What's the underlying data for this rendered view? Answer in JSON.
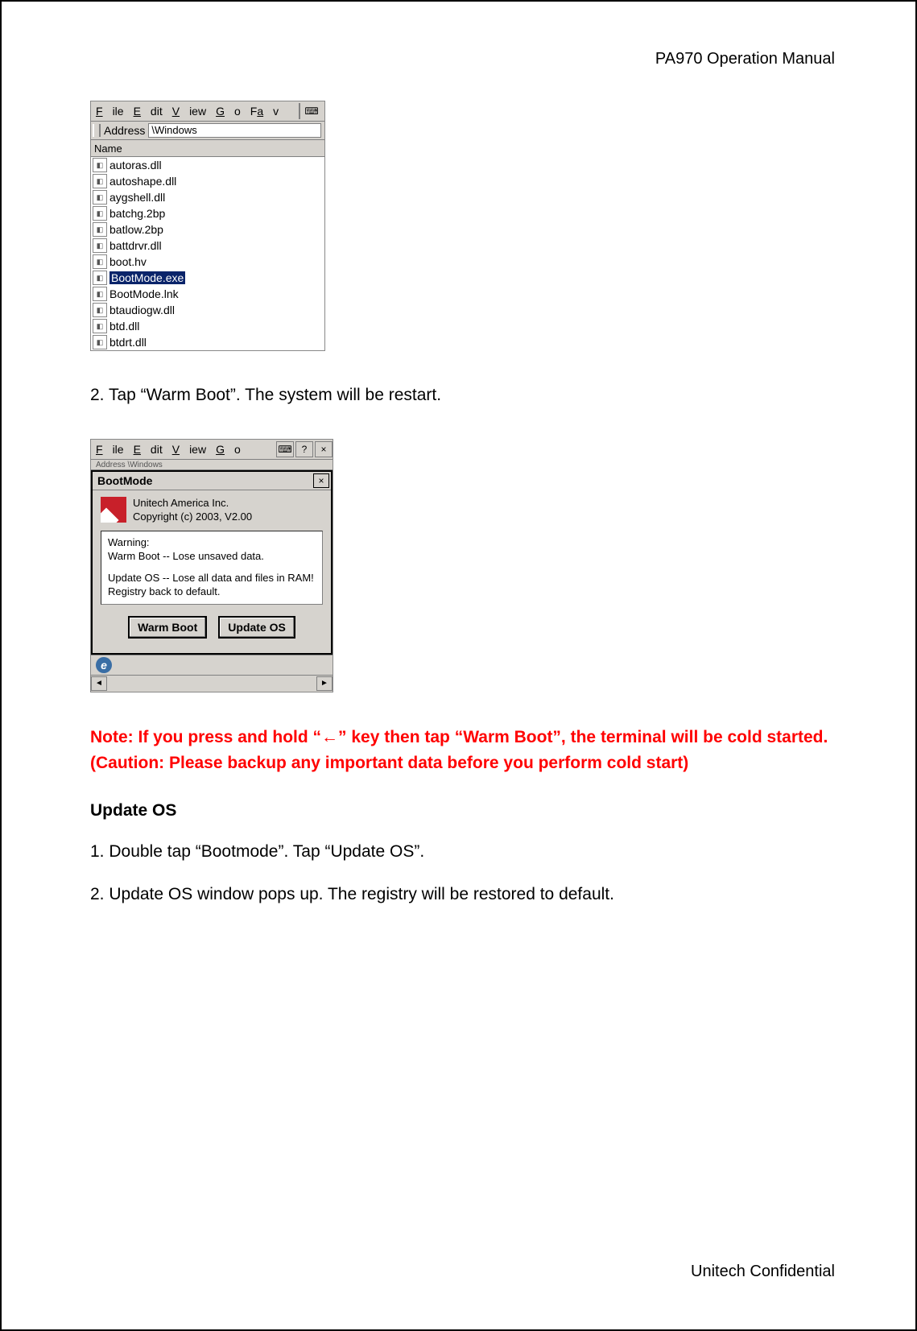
{
  "header": "PA970 Operation Manual",
  "footer": "Unitech Confidential",
  "screenshot1": {
    "menubar": {
      "file": "File",
      "edit": "Edit",
      "view": "View",
      "go": "Go",
      "fav": "Fav"
    },
    "address_label": "Address",
    "address_value": "\\Windows",
    "name_header": "Name",
    "files": [
      "autoras.dll",
      "autoshape.dll",
      "aygshell.dll",
      "batchg.2bp",
      "batlow.2bp",
      "battdrvr.dll",
      "boot.hv",
      "BootMode.exe",
      "BootMode.lnk",
      "btaudiogw.dll",
      "btd.dll",
      "btdrt.dll"
    ],
    "selected_index": 7
  },
  "step2": "2. Tap “Warm Boot”. The system will be restart.",
  "screenshot2": {
    "menubar": {
      "file": "File",
      "edit": "Edit",
      "view": "View",
      "go": "Go"
    },
    "toolbar": {
      "help": "?",
      "close": "×"
    },
    "addr_stub": "Address \\Windows",
    "dialog_title": "BootMode",
    "close_btn": "×",
    "company": "Unitech America Inc.",
    "copyright": "Copyright (c) 2003, V2.00",
    "warning_l1": "Warning:",
    "warning_l2": "Warm Boot -- Lose unsaved data.",
    "warning_l3": "Update OS -- Lose all data and files in RAM! Registry back to default.",
    "btn_warm": "Warm Boot",
    "btn_update": "Update OS",
    "scroll_left": "◄",
    "scroll_right": "►"
  },
  "note": "Note: If you press and hold “←” key then tap “Warm Boot”, the terminal will be cold started. (Caution: Please backup any important data before you perform cold start)",
  "section_updateos": "Update OS",
  "updateos_step1": "1. Double tap “Bootmode”. Tap “Update OS”.",
  "updateos_step2": "2. Update OS window pops up. The registry will be restored to default."
}
